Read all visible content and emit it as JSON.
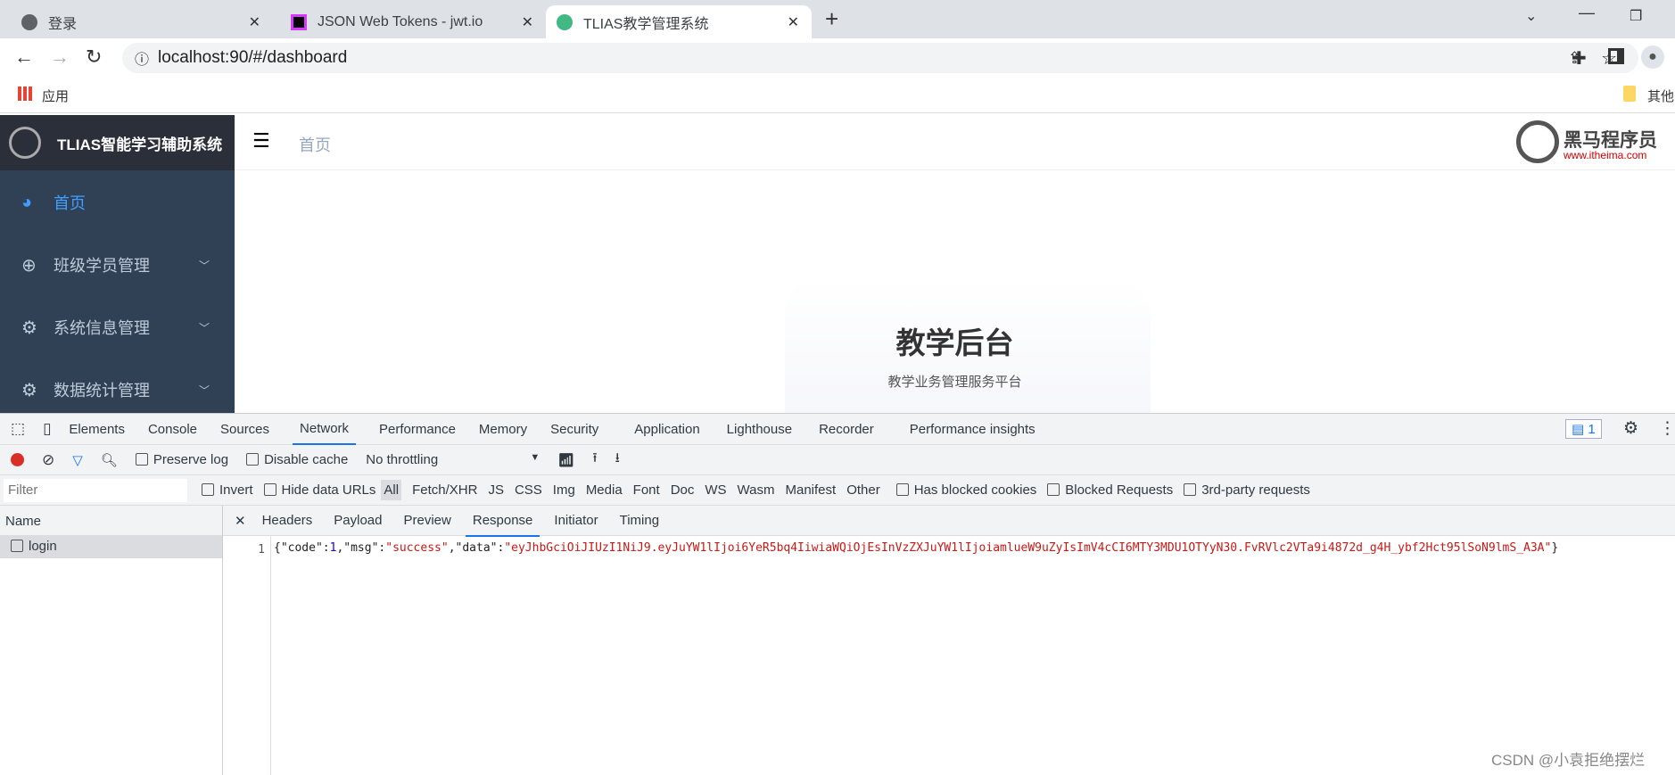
{
  "browser": {
    "tabs": [
      {
        "title": "登录",
        "icon": "globe-icon"
      },
      {
        "title": "JSON Web Tokens - jwt.io",
        "icon": "jwt-icon"
      },
      {
        "title": "TLIAS教学管理系统",
        "icon": "vue-icon",
        "active": true
      }
    ],
    "url": "localhost:90/#/dashboard",
    "bookmarks": {
      "apps": "应用",
      "other": "其他"
    }
  },
  "app": {
    "title": "TLIAS智能学习辅助系统",
    "breadcrumb": "首页",
    "brand": {
      "name": "黑马程序员",
      "url": "www.itheima.com"
    },
    "menu": [
      {
        "label": "首页",
        "icon": "dashboard-icon",
        "active": true
      },
      {
        "label": "班级学员管理",
        "icon": "plus-circle-icon"
      },
      {
        "label": "系统信息管理",
        "icon": "gear-icon"
      },
      {
        "label": "数据统计管理",
        "icon": "gear-icon"
      }
    ],
    "hero": {
      "title": "教学后台",
      "subtitle": "教学业务管理服务平台"
    },
    "accent": "#409eff",
    "sidebar_bg": "#304156"
  },
  "devtools": {
    "tabs": [
      "Elements",
      "Console",
      "Sources",
      "Network",
      "Performance",
      "Memory",
      "Security",
      "Application",
      "Lighthouse",
      "Recorder",
      "Performance insights"
    ],
    "active_tab": "Network",
    "issues_count": "1",
    "toolbar": {
      "preserve_log": "Preserve log",
      "disable_cache": "Disable cache",
      "throttling": "No throttling"
    },
    "filter": {
      "placeholder": "Filter",
      "invert": "Invert",
      "hide_data_urls": "Hide data URLs",
      "types": [
        "All",
        "Fetch/XHR",
        "JS",
        "CSS",
        "Img",
        "Media",
        "Font",
        "Doc",
        "WS",
        "Wasm",
        "Manifest",
        "Other"
      ],
      "has_blocked_cookies": "Has blocked cookies",
      "blocked_requests": "Blocked Requests",
      "third_party": "3rd-party requests"
    },
    "name_header": "Name",
    "requests": [
      "login"
    ],
    "detail_tabs": [
      "Headers",
      "Payload",
      "Preview",
      "Response",
      "Initiator",
      "Timing"
    ],
    "active_detail_tab": "Response",
    "response": {
      "line": "1",
      "p1": "{\"code\":",
      "code": "1",
      "p2": ",\"msg\":",
      "msg": "\"success\"",
      "p3": ",\"data\":",
      "data": "\"eyJhbGciOiJIUzI1NiJ9.eyJuYW1lIjoi6YeR5bq4IiwiaWQiOjEsInVzZXJuYW1lIjoiamlueW9uZyIsImV4cCI6MTY3MDU1OTYyN30.FvRVlc2VTa9i4872d_g4H_ybf2Hct95lSoN9lmS_A3A\"",
      "p4": "}"
    }
  },
  "watermark": "CSDN @小袁拒绝摆烂"
}
